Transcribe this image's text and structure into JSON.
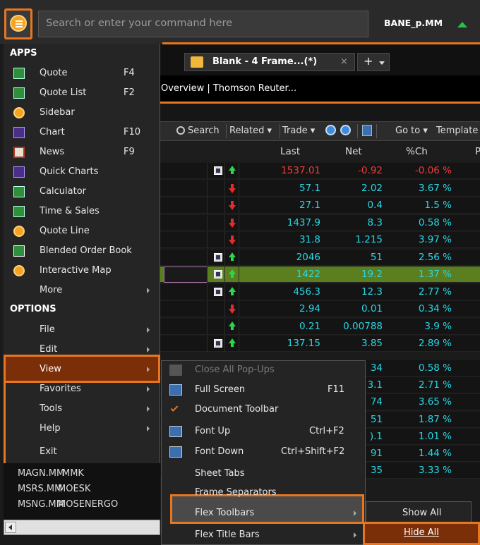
{
  "topbar": {
    "search_placeholder": "Search or enter your command here",
    "ric": "BANE_p.MM"
  },
  "background": {
    "tab_label": "Blank - 4 Frame...(*)",
    "tab_close": "×",
    "plus": "+",
    "link_text": "Overview | Thomson Reuter...",
    "toolbar": {
      "search": "Search",
      "related": "Related ▾",
      "trade": "Trade ▾",
      "goto": "Go to ▾",
      "template": "Template"
    },
    "headers": {
      "last": "Last",
      "net": "Net",
      "pct": "%Ch",
      "p": "P"
    },
    "rows": [
      {
        "news": true,
        "dir": "up",
        "last": "1537.01",
        "net": "-0.92",
        "pct": "-0.06 %",
        "neg": true
      },
      {
        "news": false,
        "dir": "down",
        "last": "57.1",
        "net": "2.02",
        "pct": "3.67 %"
      },
      {
        "news": false,
        "dir": "down",
        "last": "27.1",
        "net": "0.4",
        "pct": "1.5 %"
      },
      {
        "news": false,
        "dir": "down",
        "last": "1437.9",
        "net": "8.3",
        "pct": "0.58 %"
      },
      {
        "news": false,
        "dir": "down",
        "last": "31.8",
        "net": "1.215",
        "pct": "3.97 %"
      },
      {
        "news": true,
        "dir": "up",
        "last": "2046",
        "net": "51",
        "pct": "2.56 %"
      },
      {
        "news": true,
        "dir": "up",
        "last": "1422",
        "net": "19.2",
        "pct": "1.37 %",
        "selected": true
      },
      {
        "news": true,
        "dir": "up",
        "last": "456.3",
        "net": "12.3",
        "pct": "2.77 %"
      },
      {
        "news": false,
        "dir": "down",
        "last": "2.94",
        "net": "0.01",
        "pct": "0.34 %"
      },
      {
        "news": false,
        "dir": "up",
        "last": "0.21",
        "net": "0.00788",
        "pct": "3.9 %"
      },
      {
        "news": true,
        "dir": "up",
        "last": "137.15",
        "net": "3.85",
        "pct": "2.89 %"
      }
    ],
    "partial_rows": [
      {
        "net": "34",
        "pct": "0.58 %"
      },
      {
        "net": "3.1",
        "pct": "2.71 %"
      },
      {
        "net": "74",
        "pct": "3.65 %"
      },
      {
        "net": "51",
        "pct": "1.87 %"
      },
      {
        "net": ").1",
        "pct": "1.01 %"
      },
      {
        "net": "91",
        "pct": "1.44 %"
      },
      {
        "net": "35",
        "pct": "3.33 %"
      }
    ]
  },
  "menu": {
    "apps_header": "APPS",
    "apps": [
      {
        "label": "Quote",
        "key": "F4",
        "icon": "quote-icon"
      },
      {
        "label": "Quote List",
        "key": "F2",
        "icon": "quote-list-icon"
      },
      {
        "label": "Sidebar",
        "key": "",
        "icon": "sidebar-icon"
      },
      {
        "label": "Chart",
        "key": "F10",
        "icon": "chart-icon"
      },
      {
        "label": "News",
        "key": "F9",
        "icon": "news-icon"
      },
      {
        "label": "Quick Charts",
        "key": "",
        "icon": "quick-charts-icon"
      },
      {
        "label": "Calculator",
        "key": "",
        "icon": "calculator-icon"
      },
      {
        "label": "Time & Sales",
        "key": "",
        "icon": "time-sales-icon"
      },
      {
        "label": "Quote Line",
        "key": "",
        "icon": "quote-line-icon"
      },
      {
        "label": "Blended Order Book",
        "key": "",
        "icon": "order-book-icon"
      },
      {
        "label": "Interactive Map",
        "key": "",
        "icon": "map-icon"
      },
      {
        "label": "More",
        "key": "",
        "arrow": true
      }
    ],
    "options_header": "OPTIONS",
    "options": [
      {
        "label": "File"
      },
      {
        "label": "Edit"
      },
      {
        "label": "View"
      },
      {
        "label": "Favorites"
      },
      {
        "label": "Tools"
      },
      {
        "label": "Help"
      },
      {
        "label": "Exit"
      }
    ]
  },
  "bottom_list": [
    {
      "ric": "MAGN.MM",
      "name": "MMK"
    },
    {
      "ric": "MSRS.MM",
      "name": "MOESK"
    },
    {
      "ric": "MSNG.MM",
      "name": "MOSENERGO"
    }
  ],
  "submenu": {
    "items": [
      {
        "label": "Close All Pop-Ups",
        "key": "",
        "disabled": true
      },
      {
        "label": "Full Screen",
        "key": "F11"
      },
      {
        "label": "Document Toolbar",
        "key": "",
        "checked": true
      },
      {
        "label": "Font Up",
        "key": "Ctrl+F2"
      },
      {
        "label": "Font Down",
        "key": "Ctrl+Shift+F2"
      },
      {
        "label": "Sheet Tabs",
        "key": ""
      },
      {
        "label": "Frame Separators",
        "key": ""
      },
      {
        "label": "Flex Toolbars",
        "key": "",
        "arrow": true
      },
      {
        "label": "Flex Title Bars",
        "key": "",
        "arrow": true
      }
    ]
  },
  "subsubmenu": {
    "show_all": "Show All",
    "hide_all": "Hide All"
  },
  "colors": {
    "accent_orange": "#e8761e",
    "up_green": "#2bd64a",
    "down_red": "#e62a2a",
    "value_cyan": "#29d6e6"
  }
}
